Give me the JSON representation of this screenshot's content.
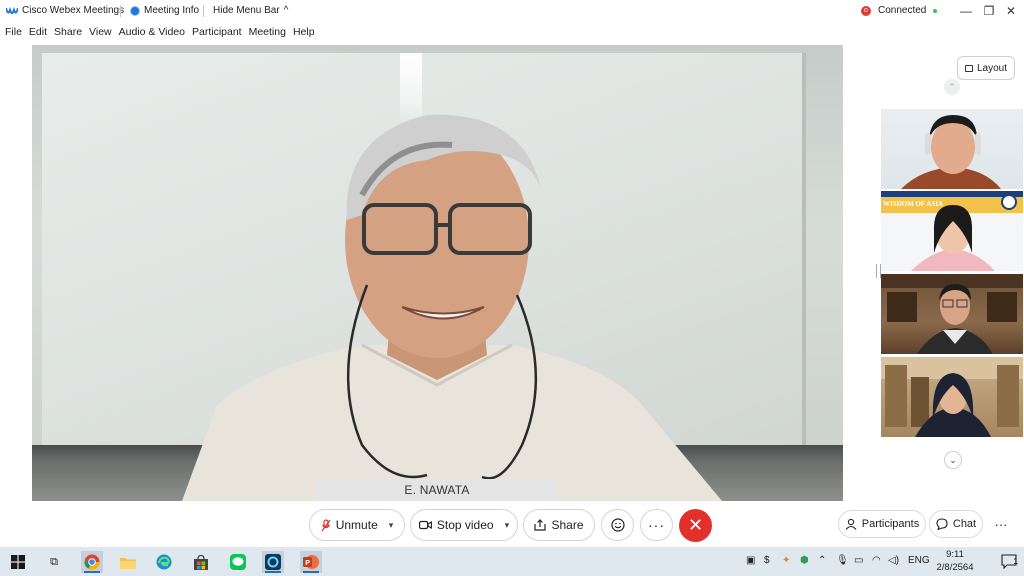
{
  "titlebar": {
    "app_name": "Cisco Webex Meetings",
    "meeting_info": "Meeting Info",
    "hide_menu": "Hide Menu Bar",
    "status": "Connected"
  },
  "menu": [
    "File",
    "Edit",
    "Share",
    "View",
    "Audio & Video",
    "Participant",
    "Meeting",
    "Help"
  ],
  "main_video": {
    "speaker_name": "E. NAWATA"
  },
  "side_panel": {
    "layout_label": "Layout"
  },
  "controls": {
    "unmute": "Unmute",
    "stop_video": "Stop video",
    "share": "Share",
    "participants": "Participants",
    "chat": "Chat"
  },
  "thumbnails": [
    {
      "banner": ""
    },
    {
      "banner": "WISDOM OF ASIA"
    },
    {
      "banner": ""
    },
    {
      "banner": ""
    }
  ],
  "taskbar": {
    "lang": "ENG",
    "time": "9:11",
    "date": "2/8/2564",
    "notification_count": "1"
  },
  "colors": {
    "end_call": "#e3302a",
    "connected": "#3dbf5a",
    "taskbar": "#dfe7ef"
  }
}
